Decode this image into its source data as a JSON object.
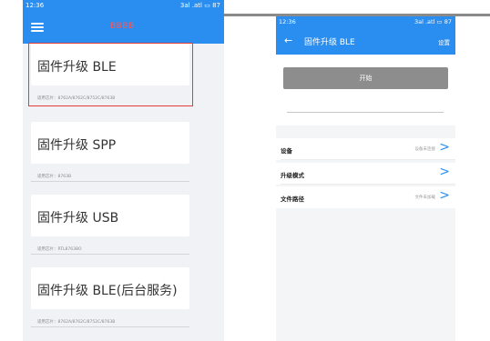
{
  "left": {
    "status": {
      "time": "12:36",
      "signal": "3al .atl",
      "battery": "87"
    },
    "appbar": {
      "title": "BBBB"
    },
    "items": [
      {
        "label": "固件升级 BLE",
        "chips": "适用芯片：8762A/8762C/8752C/8763B"
      },
      {
        "label": "固件升级 SPP",
        "chips": "适用芯片：8763B"
      },
      {
        "label": "固件升级 USB",
        "chips": "适用芯片：RTL8763BO"
      },
      {
        "label": "固件升级 BLE(后台服务)",
        "chips": "适用芯片：8762A/8762C/8752C/8763B"
      }
    ]
  },
  "right": {
    "status": {
      "time": "12:36",
      "signal": "3al .atl",
      "battery": "87"
    },
    "appbar": {
      "back": "←",
      "title": "固件升级 BLE",
      "settings": "设置"
    },
    "start_button": "开始",
    "rows": [
      {
        "label": "设备",
        "value": "设备未连接",
        "chevron": ">"
      },
      {
        "label": "升级模式",
        "value": "",
        "chevron": ">"
      },
      {
        "label": "文件路径",
        "value": "文件未加载",
        "chevron": ">"
      }
    ]
  },
  "colors": {
    "primary": "#2a8ef0",
    "highlight": "#e43b3b",
    "disabled_button": "#8d8d8d"
  }
}
